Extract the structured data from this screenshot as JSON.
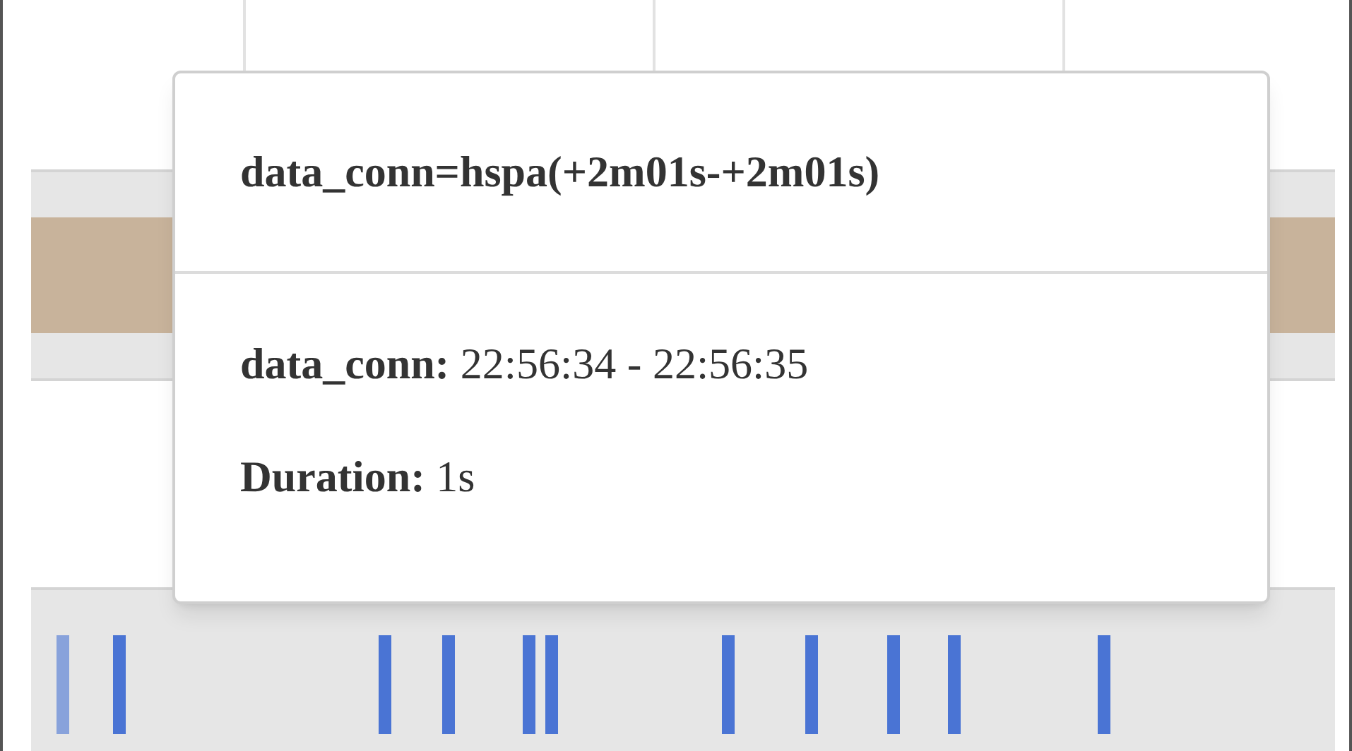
{
  "tooltip": {
    "title": "data_conn=hspa(+2m01s-+2m01s)",
    "lines": [
      "**data_conn:** 22:56:34 - 22:56:35",
      "**Duration:** 1s"
    ]
  }
}
